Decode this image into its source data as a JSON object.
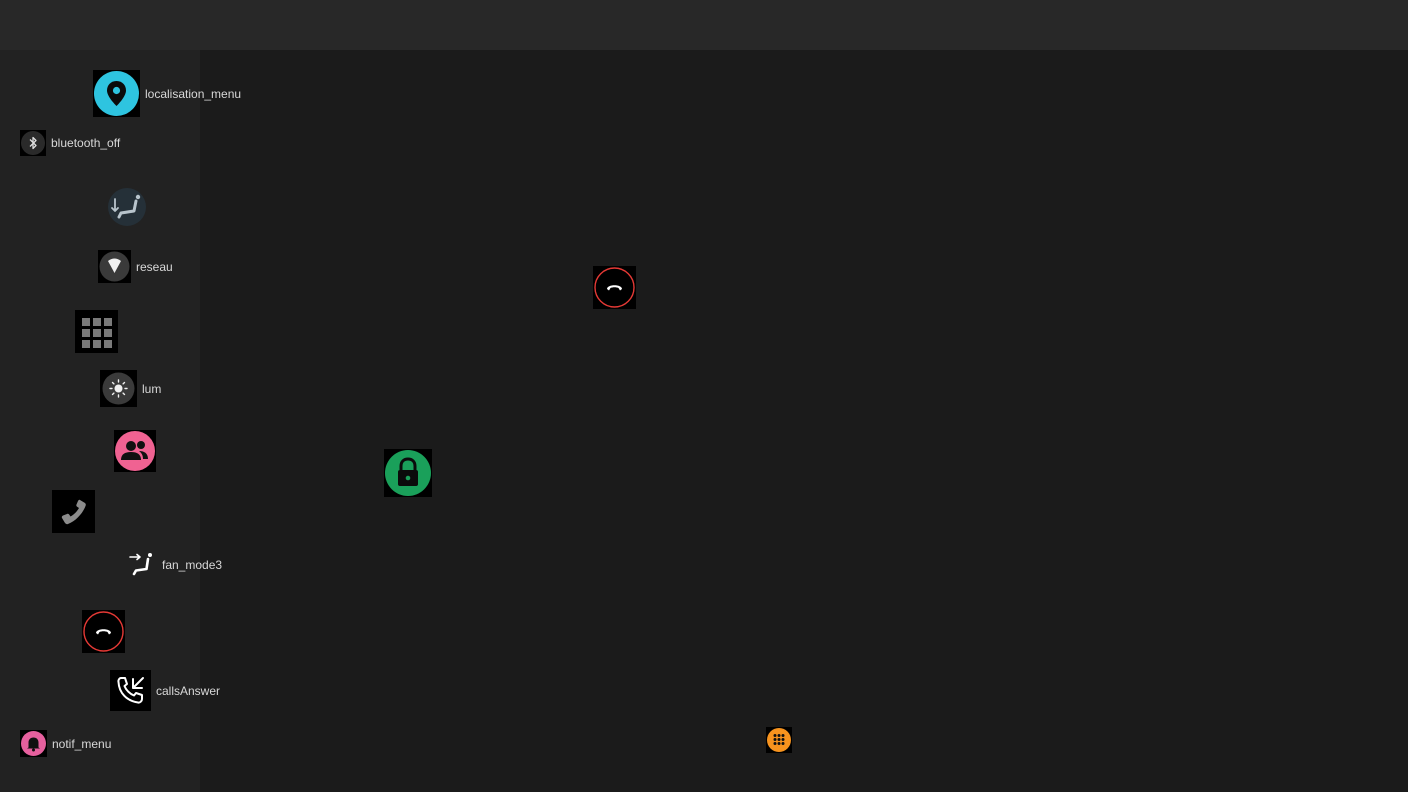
{
  "labels": {
    "localisation": "localisation_menu",
    "bluetooth": "bluetooth_off",
    "reseau": "reseau",
    "lum": "lum",
    "fan": "fan_mode3",
    "calls_answer": "callsAnswer",
    "notif": "notif_menu"
  },
  "icons": [
    {
      "name": "localisation-menu-icon",
      "color": "#2ec4e0"
    },
    {
      "name": "bluetooth-off-icon",
      "color": "#2a2a2a"
    },
    {
      "name": "fan-seat-icon",
      "color": "#253038"
    },
    {
      "name": "reseau-icon",
      "color": "#3a3a3a"
    },
    {
      "name": "grid-apps-icon",
      "color": "#7a7a7a"
    },
    {
      "name": "lum-brightness-icon",
      "color": "#3a3a3a"
    },
    {
      "name": "contacts-icon",
      "color": "#f06292"
    },
    {
      "name": "phone-icon",
      "color": "#8c8c8c"
    },
    {
      "name": "fan-mode3-icon",
      "color": "#ffffff"
    },
    {
      "name": "hangup-icon",
      "color": "#e53935"
    },
    {
      "name": "calls-answer-icon",
      "color": "#ffffff"
    },
    {
      "name": "notif-menu-icon",
      "color": "#e6609e"
    },
    {
      "name": "hangup-icon-canvas",
      "color": "#e53935"
    },
    {
      "name": "lock-icon",
      "color": "#1aa05a"
    },
    {
      "name": "dialpad-icon",
      "color": "#f7931e"
    }
  ],
  "colors": {
    "topbar": "#282828",
    "sidebar": "#222222",
    "canvas": "#1b1b1b",
    "label_text": "#d8d8d8"
  }
}
